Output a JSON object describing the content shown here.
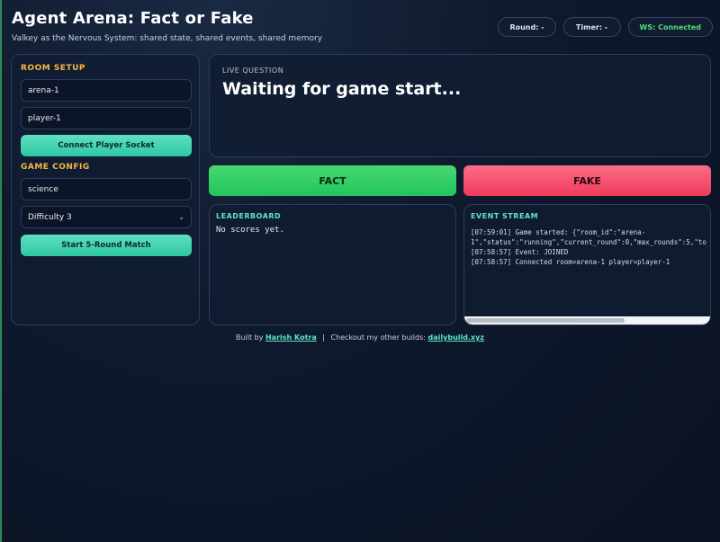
{
  "header": {
    "title": "Agent Arena: Fact or Fake",
    "subtitle": "Valkey as the Nervous System: shared state, shared events, shared memory",
    "round_pill": "Round: -",
    "timer_pill": "Timer: -",
    "ws_pill": "WS: Connected"
  },
  "colors": {
    "accent_teal": "#5ee6c4",
    "section_orange": "#f5b942",
    "fact_green": "#22c55e",
    "fake_red": "#ef3b5c",
    "ws_green": "#4ade80"
  },
  "setup": {
    "room_title": "ROOM SETUP",
    "room_id_value": "arena-1",
    "player_id_value": "player-1",
    "connect_label": "Connect Player Socket",
    "config_title": "GAME CONFIG",
    "topic_value": "science",
    "difficulty_selected": "Difficulty 3",
    "start_label": "Start 5-Round Match"
  },
  "question": {
    "label": "LIVE QUESTION",
    "text": "Waiting for game start..."
  },
  "answers": {
    "fact_label": "FACT",
    "fake_label": "FAKE"
  },
  "leaderboard": {
    "title": "LEADERBOARD",
    "empty_text": "No scores yet."
  },
  "events": {
    "title": "EVENT STREAM",
    "lines": [
      "[07:59:01] Game started: {\"room_id\":\"arena-",
      "1\",\"status\":\"running\",\"current_round\":0,\"max_rounds\":5,\"to",
      "[07:58:57] Event: JOINED",
      "[07:58:57] Connected room=arena-1 player=player-1"
    ]
  },
  "footer": {
    "built_by": "Built by",
    "author": "Harish Kotra",
    "separator": "|",
    "other": "Checkout my other builds:",
    "site": "dailybuild.xyz"
  }
}
